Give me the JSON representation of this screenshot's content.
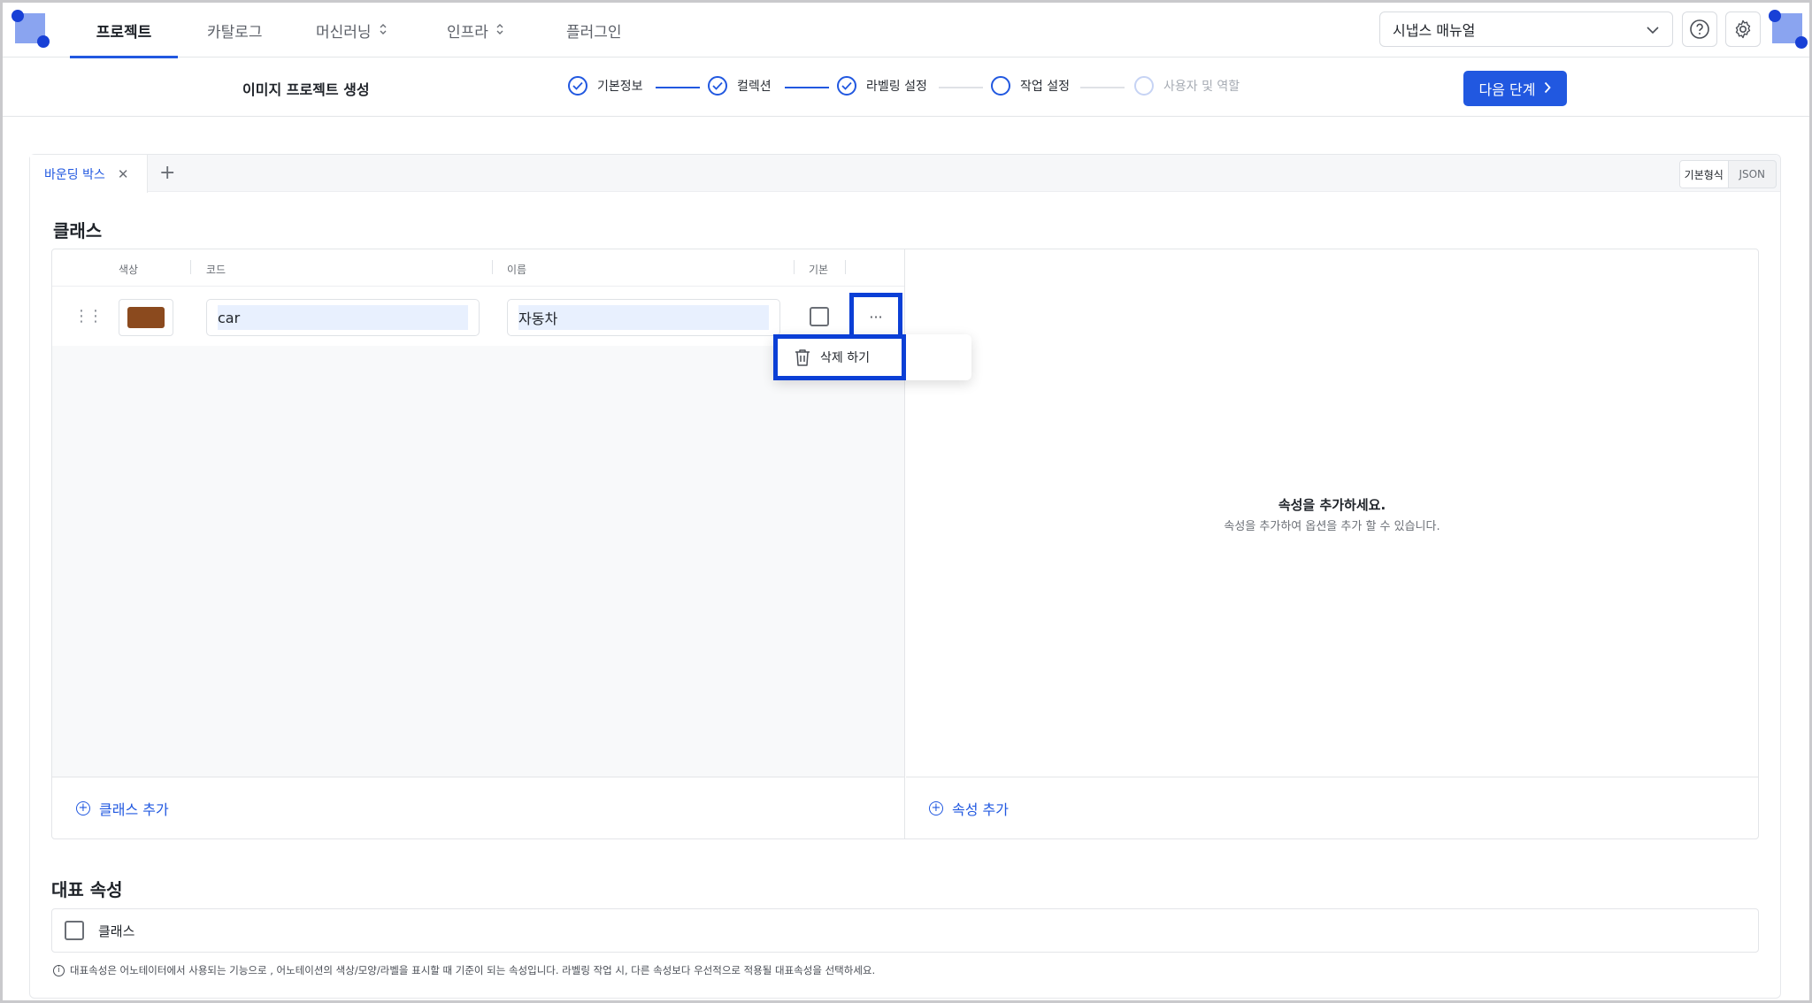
{
  "nav": {
    "tabs": [
      {
        "label": "프로젝트",
        "active": true
      },
      {
        "label": "카탈로그"
      },
      {
        "label": "머신러닝",
        "chevron": "⌃⌄"
      },
      {
        "label": "인프라",
        "chevron": "⌃⌄"
      },
      {
        "label": "플러그인"
      }
    ],
    "manual_select": "시냅스 매뉴얼",
    "accent": "#2158e0"
  },
  "stepper": {
    "page_title": "이미지 프로젝트 생성",
    "steps": [
      {
        "label": "기본정보",
        "status": "done"
      },
      {
        "label": "컬렉션",
        "status": "done"
      },
      {
        "label": "라벨링 설정",
        "status": "done"
      },
      {
        "label": "작업 설정",
        "status": "current"
      },
      {
        "label": "사용자 및 역할",
        "status": "disabled"
      }
    ],
    "next_button": "다음 단계"
  },
  "editor": {
    "tab_label": "바운딩 박스",
    "view_toggle": {
      "basic": "기본형식",
      "json": "JSON"
    },
    "classes_title": "클래스",
    "columns": {
      "color": "색상",
      "code": "코드",
      "name": "이름",
      "default": "기본"
    },
    "rows": [
      {
        "color": "#8b4a1e",
        "code": "car",
        "name": "자동차",
        "default": false
      }
    ],
    "more_label": "···",
    "menu": {
      "delete": "삭제 하기"
    },
    "add_class": "클래스 추가",
    "add_attribute": "속성 추가",
    "empty_title": "속성을 추가하세요.",
    "empty_sub": "속성을 추가하여 옵션을 추가 할 수 있습니다."
  },
  "representative": {
    "title": "대표 속성",
    "option": "클래스",
    "note": "대표속성은 어노테이터에서 사용되는 기능으로 , 어노테이션의 색상/모양/라벨을 표시할 때 기준이 되는 속성입니다. 라벨링 작업 시, 다른 속성보다 우선적으로 적용될 대표속성을 선택하세요."
  }
}
